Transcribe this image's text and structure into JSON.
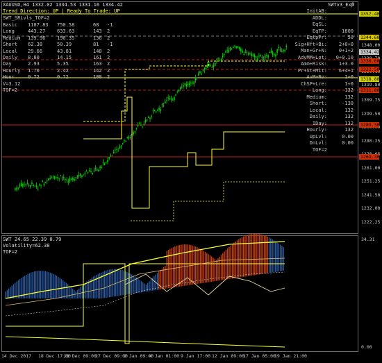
{
  "header": {
    "symbol_line": "XAUUSD,H4  1332.02  1334.53  1331.16  1334.42",
    "trend_line": "Trend Direction:  UP  |  Ready To Trade:  UP",
    "expert_label": "SWTv3_Exp"
  },
  "left_panel": {
    "title": "SWT_SRLvls_TOF=2",
    "rows": [
      {
        "name": "Basic",
        "a": "1107.83",
        "b": "750.58",
        "c": "68",
        "d": "-1"
      },
      {
        "name": "Long",
        "a": "443.27",
        "b": "633.63",
        "c": "143",
        "d": "2"
      },
      {
        "name": "Medium",
        "a": "139.96",
        "b": "190.35",
        "c": "136",
        "d": "2"
      },
      {
        "name": "Short",
        "a": "62.38",
        "b": "50.39",
        "c": "81",
        "d": "-1"
      },
      {
        "name": "Local",
        "a": "29.66",
        "b": "43.81",
        "c": "148",
        "d": "2"
      },
      {
        "name": "Daily",
        "a": "8.80",
        "b": "14.15",
        "c": "161",
        "d": "2"
      },
      {
        "name": "Day",
        "a": "2.93",
        "b": "5.35",
        "c": "163",
        "d": "2"
      },
      {
        "name": "Hourly",
        "a": "1.70",
        "b": "2.42",
        "c": "142",
        "d": "2"
      },
      {
        "name": "Hour",
        "a": "0.72",
        "b": "0.72",
        "c": "108",
        "d": "2"
      }
    ],
    "version": "V=3.12",
    "tof": "TOF=2"
  },
  "right_labels": [
    {
      "text": "InitAB:",
      "val": ""
    },
    {
      "text": "ADDL:",
      "val": ""
    },
    {
      "text": "EqSL:",
      "val": ""
    },
    {
      "text": "EqTP:",
      "val": "1800"
    },
    {
      "text": "EqtpPr:",
      "val": "50"
    },
    {
      "text": "Sig+Hft+Bi:",
      "val": "2+0+0"
    },
    {
      "text": "Man+Gr+N:",
      "val": "0+1+2"
    },
    {
      "text": "AdvMM+Lot:",
      "val": "0+0.10"
    },
    {
      "text": "Amm+Risk:",
      "val": "1+3.0"
    },
    {
      "text": "Pr+St+Mit:",
      "val": "6+4+1"
    },
    {
      "text": "AvM+Ro:",
      "val": "1+0"
    },
    {
      "text": "ChSP+Lre:",
      "val": "1+0"
    },
    {
      "text": "Long:",
      "val": "132"
    },
    {
      "text": "Medium:",
      "val": "132"
    },
    {
      "text": "Short:",
      "val": "-130"
    },
    {
      "text": "Local:",
      "val": "132"
    },
    {
      "text": "Daily:",
      "val": "132"
    },
    {
      "text": "IDay:",
      "val": "132"
    },
    {
      "text": "Hourly:",
      "val": "132"
    },
    {
      "text": "UpLvl:",
      "val": "0.00"
    },
    {
      "text": "DnLvl:",
      "val": "0.00"
    },
    {
      "text": "TOF=2",
      "val": ""
    }
  ],
  "price_axis": {
    "ticks": [
      "1348.00",
      "1338.70",
      "1329.10",
      "1319.80",
      "1309.75",
      "1299.50",
      "1290.00",
      "1280.25",
      "1270.65",
      "1261.00",
      "1251.25",
      "1241.50",
      "1232.00",
      "1222.25"
    ],
    "tags": [
      {
        "text": "1357.40",
        "color": "#c8c800"
      },
      {
        "text": "1344.60",
        "color": "#d4c400"
      },
      {
        "text": "1334.42",
        "color": "#c8c8c8"
      },
      {
        "text": "1330.60",
        "color": "#d03000"
      },
      {
        "text": "1322.50",
        "color": "#d03000"
      },
      {
        "text": "1318.80",
        "color": "#d4d400"
      },
      {
        "text": "1311.80",
        "color": "#d03000"
      },
      {
        "text": "1289.30",
        "color": "#d03000"
      },
      {
        "text": "1269.30",
        "color": "#d03000"
      }
    ]
  },
  "sub_panel": {
    "title_line": "SWT  24.65  22.39  0.79",
    "volatility": "Volatility=62.38",
    "tof": "TOF=2",
    "axis_top": "34.31",
    "axis_bottom": "0.00"
  },
  "time_axis": [
    "14 Dec 2017",
    "18 Dec 17:00",
    "21 Dec 09:00",
    "27 Dec 09:00",
    "2 Jan 09:00",
    "4 Jan 01:00",
    "9 Jan 17:00",
    "12 Jan 09:00",
    "17 Jan 05:00",
    "19 Jan 21:00"
  ],
  "colors": {
    "candle": "#00d000",
    "yellow": "#ffff33",
    "red_line": "#c81e1e",
    "dash": "#7a7a7a",
    "bar_red": "#c84010",
    "bar_blue": "#2a5aa0"
  }
}
